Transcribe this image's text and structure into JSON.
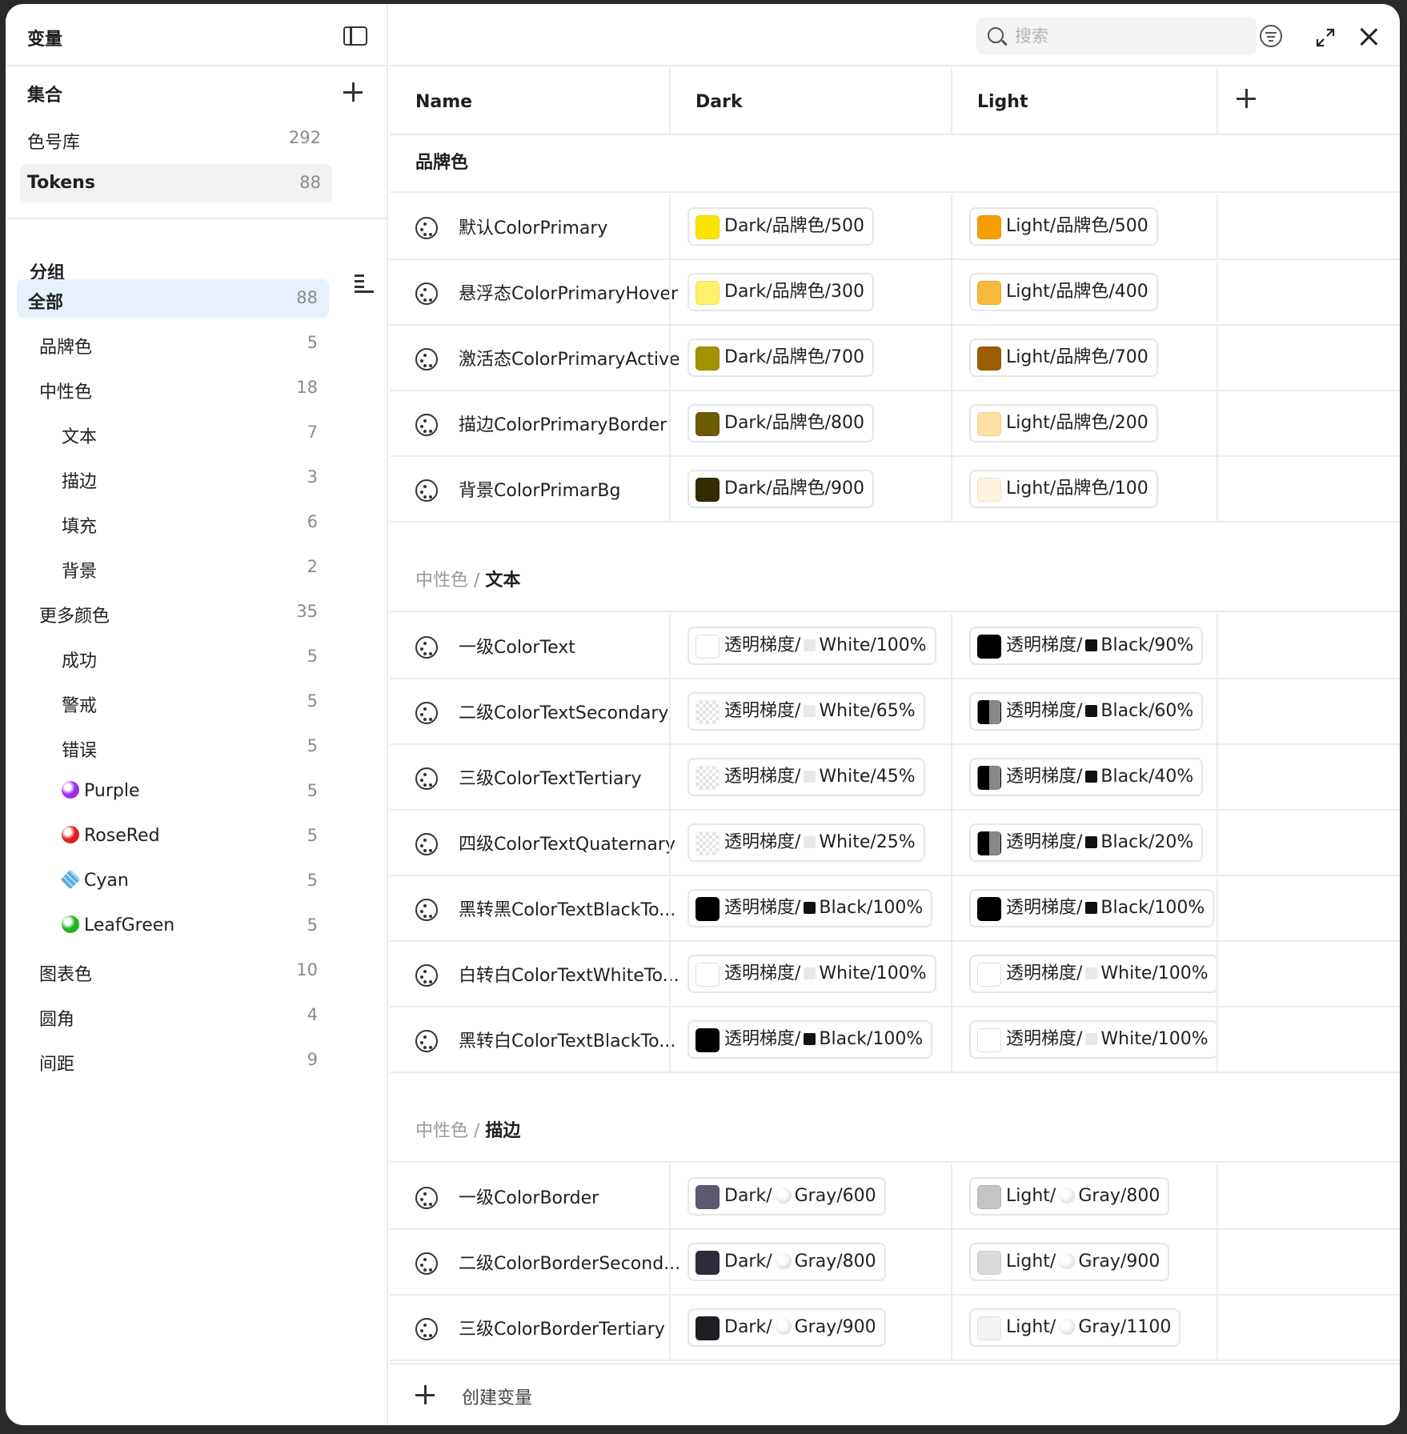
{
  "sidebar": {
    "title": "变量",
    "collections_title": "集合",
    "collections": [
      {
        "label": "色号库",
        "count": "292",
        "selected": false
      },
      {
        "label": "Tokens",
        "count": "88",
        "selected": true
      }
    ],
    "groups_title": "分组",
    "groups": [
      {
        "label": "全部",
        "count": "88",
        "level": 0,
        "selected": true
      },
      {
        "label": "品牌色",
        "count": "5",
        "level": 1
      },
      {
        "label": "中性色",
        "count": "18",
        "level": 1
      },
      {
        "label": "文本",
        "count": "7",
        "level": 2
      },
      {
        "label": "描边",
        "count": "3",
        "level": 2
      },
      {
        "label": "填充",
        "count": "6",
        "level": 2
      },
      {
        "label": "背景",
        "count": "2",
        "level": 2
      },
      {
        "label": "更多颜色",
        "count": "35",
        "level": 1
      },
      {
        "label": "成功",
        "count": "5",
        "level": 2
      },
      {
        "label": "警戒",
        "count": "5",
        "level": 2
      },
      {
        "label": "错误",
        "count": "5",
        "level": 2
      },
      {
        "label": "Purple",
        "count": "5",
        "level": 2,
        "dot": "#9b30e8"
      },
      {
        "label": "RoseRed",
        "count": "5",
        "level": 2,
        "dot": "#e02020"
      },
      {
        "label": "Cyan",
        "count": "5",
        "level": 2,
        "dot": "diamond"
      },
      {
        "label": "LeafGreen",
        "count": "5",
        "level": 2,
        "dot": "#22b322"
      },
      {
        "label": "图表色",
        "count": "10",
        "level": 1
      },
      {
        "label": "圆角",
        "count": "4",
        "level": 1
      },
      {
        "label": "间距",
        "count": "9",
        "level": 1
      }
    ]
  },
  "search": {
    "placeholder": "搜索"
  },
  "columns": {
    "name": "Name",
    "dark": "Dark",
    "light": "Light"
  },
  "sections": [
    {
      "path_prefix": "",
      "title": "品牌色",
      "rows": [
        {
          "name": "默认ColorPrimary",
          "dark": {
            "swatch": "#fde400",
            "text": "Dark/品牌色/500"
          },
          "light": {
            "swatch": "#f5a000",
            "text": "Light/品牌色/500"
          }
        },
        {
          "name": "悬浮态ColorPrimaryHover",
          "dark": {
            "swatch": "#fff06a",
            "text": "Dark/品牌色/300"
          },
          "light": {
            "swatch": "#f8b93a",
            "text": "Light/品牌色/400"
          }
        },
        {
          "name": "激活态ColorPrimaryActive",
          "dark": {
            "swatch": "#a39200",
            "text": "Dark/品牌色/700"
          },
          "light": {
            "swatch": "#9a5e00",
            "text": "Light/品牌色/700"
          }
        },
        {
          "name": "描边ColorPrimaryBorder",
          "dark": {
            "swatch": "#6b5c00",
            "text": "Dark/品牌色/800"
          },
          "light": {
            "swatch": "#fde0a6",
            "text": "Light/品牌色/200"
          }
        },
        {
          "name": "背景ColorPrimarBg",
          "dark": {
            "swatch": "#332c00",
            "text": "Dark/品牌色/900"
          },
          "light": {
            "swatch": "#fff4e0",
            "text": "Light/品牌色/100"
          }
        }
      ]
    },
    {
      "path_prefix": "中性色 / ",
      "title": "文本",
      "rows": [
        {
          "name": "一级ColorText",
          "dark": {
            "swatch": "white",
            "pre": "透明梯度/",
            "mini": "#e8e8e8",
            "text": "White/100%"
          },
          "light": {
            "swatch": "black",
            "pre": "透明梯度/",
            "mini": "#111",
            "text": "Black/90%"
          }
        },
        {
          "name": "二级ColorTextSecondary",
          "dark": {
            "swatch": "checker-light",
            "pre": "透明梯度/",
            "mini": "#e8e8e8",
            "text": "White/65%"
          },
          "light": {
            "swatch": "half-black",
            "pre": "透明梯度/",
            "mini": "#111",
            "text": "Black/60%"
          }
        },
        {
          "name": "三级ColorTextTertiary",
          "dark": {
            "swatch": "checker-light",
            "pre": "透明梯度/",
            "mini": "#e8e8e8",
            "text": "White/45%"
          },
          "light": {
            "swatch": "half-black",
            "pre": "透明梯度/",
            "mini": "#111",
            "text": "Black/40%"
          }
        },
        {
          "name": "四级ColorTextQuaternary",
          "dark": {
            "swatch": "checker-light",
            "pre": "透明梯度/",
            "mini": "#e8e8e8",
            "text": "White/25%"
          },
          "light": {
            "swatch": "half-black",
            "pre": "透明梯度/",
            "mini": "#111",
            "text": "Black/20%"
          }
        },
        {
          "name": "黑转黑ColorTextBlackTo...",
          "dark": {
            "swatch": "black",
            "pre": "透明梯度/",
            "mini": "#111",
            "text": "Black/100%"
          },
          "light": {
            "swatch": "black",
            "pre": "透明梯度/",
            "mini": "#111",
            "text": "Black/100%"
          }
        },
        {
          "name": "白转白ColorTextWhiteTo...",
          "dark": {
            "swatch": "white",
            "pre": "透明梯度/",
            "mini": "#e8e8e8",
            "text": "White/100%"
          },
          "light": {
            "swatch": "white",
            "pre": "透明梯度/",
            "mini": "#e8e8e8",
            "text": "White/100%"
          }
        },
        {
          "name": "黑转白ColorTextBlackTo...",
          "dark": {
            "swatch": "black",
            "pre": "透明梯度/",
            "mini": "#111",
            "text": "Black/100%"
          },
          "light": {
            "swatch": "white",
            "pre": "透明梯度/",
            "mini": "#e8e8e8",
            "text": "White/100%"
          }
        }
      ]
    },
    {
      "path_prefix": "中性色 / ",
      "title": "描边",
      "rows": [
        {
          "name": "一级ColorBorder",
          "dark": {
            "swatch": "#5c5a70",
            "pre": "Dark/",
            "mini": "round",
            "text": "Gray/600"
          },
          "light": {
            "swatch": "#c4c4c4",
            "pre": "Light/",
            "mini": "round",
            "text": "Gray/800"
          }
        },
        {
          "name": "二级ColorBorderSecond...",
          "dark": {
            "swatch": "#2e2c38",
            "pre": "Dark/",
            "mini": "round",
            "text": "Gray/800"
          },
          "light": {
            "swatch": "#dadada",
            "pre": "Light/",
            "mini": "round",
            "text": "Gray/900"
          }
        },
        {
          "name": "三级ColorBorderTertiary",
          "dark": {
            "swatch": "#1e1d24",
            "pre": "Dark/",
            "mini": "round",
            "text": "Gray/900"
          },
          "light": {
            "swatch": "#f4f4f4",
            "pre": "Light/",
            "mini": "round",
            "text": "Gray/1100"
          }
        }
      ]
    }
  ],
  "footer": {
    "create_label": "创建变量"
  }
}
